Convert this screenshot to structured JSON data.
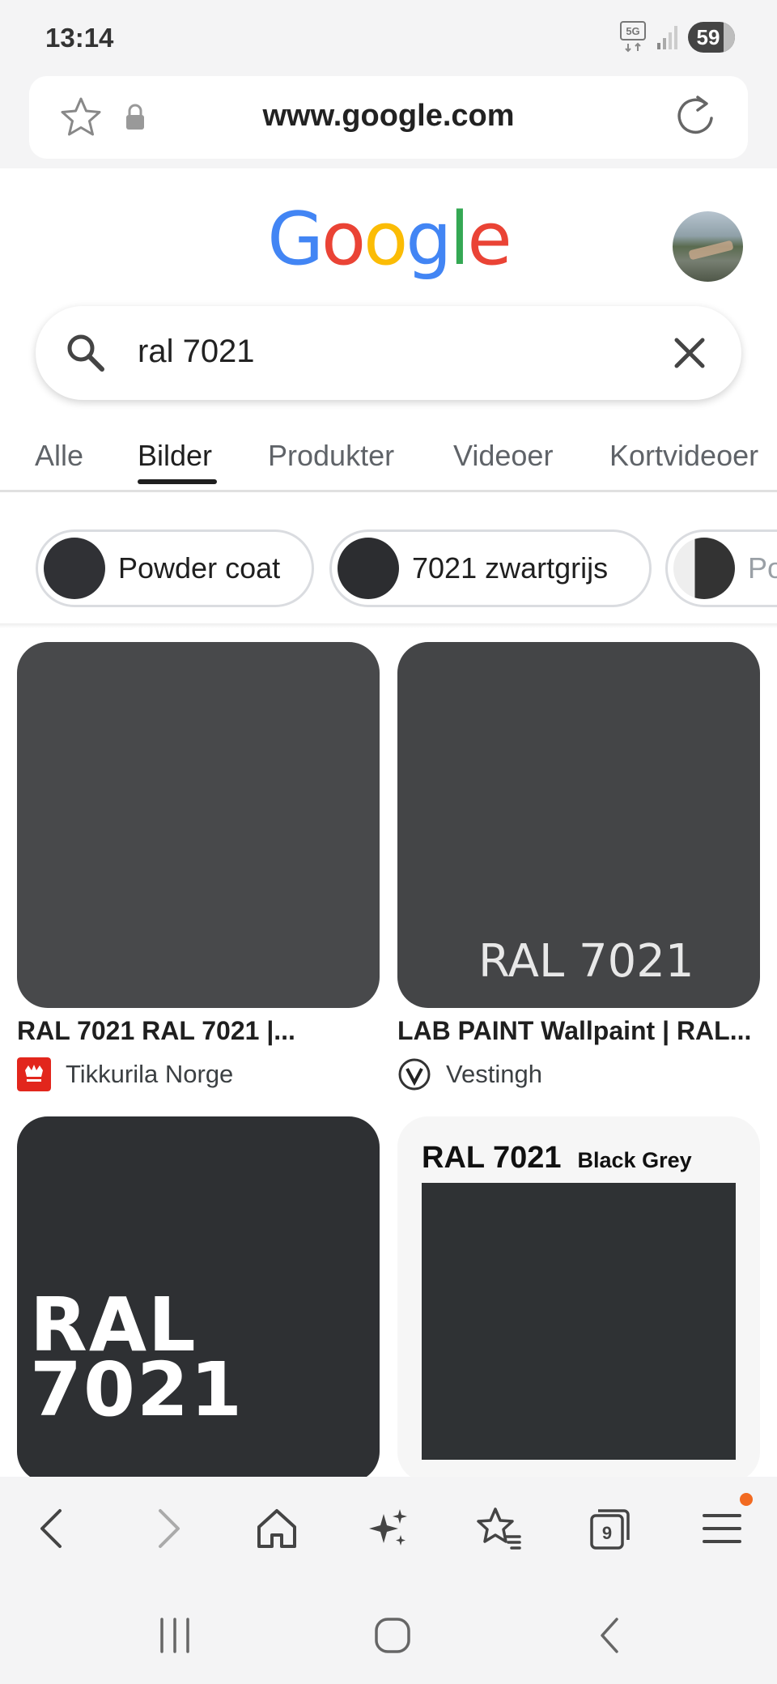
{
  "status_bar": {
    "time": "13:14",
    "network": "5G",
    "battery": "59"
  },
  "browser": {
    "url": "www.google.com"
  },
  "google": {
    "logo_letters": [
      "G",
      "o",
      "o",
      "g",
      "l",
      "e"
    ],
    "logo_colors": [
      "#4285F4",
      "#EA4335",
      "#FBBC05",
      "#4285F4",
      "#34A853",
      "#EA4335"
    ],
    "search_query": "ral 7021"
  },
  "tabs": [
    {
      "label": "Alle",
      "active": false
    },
    {
      "label": "Bilder",
      "active": true
    },
    {
      "label": "Produkter",
      "active": false
    },
    {
      "label": "Videoer",
      "active": false
    },
    {
      "label": "Kortvideoer",
      "active": false
    }
  ],
  "chips": [
    {
      "label": "Powder coat"
    },
    {
      "label": "7021 zwartgrijs"
    },
    {
      "label": "Po"
    }
  ],
  "results": [
    {
      "title": "RAL 7021 RAL 7021 |...",
      "source": "Tikkurila Norge",
      "image_color": "#48494b",
      "image_text": ""
    },
    {
      "title": "LAB PAINT Wallpaint | RAL...",
      "source": "Vestingh",
      "image_color": "#444547",
      "image_text": "RAL 7021"
    },
    {
      "title": "",
      "source": "",
      "image_color": "#2e3033",
      "image_text_line1": "RAL",
      "image_text_line2": "7021"
    },
    {
      "title": "",
      "source": "",
      "image_color": "#2f3234",
      "header_main": "RAL 7021",
      "header_sub": "Black Grey"
    }
  ],
  "toolbar": {
    "tabs_count": "9"
  },
  "colors": {
    "accent_orange": "#f26a21",
    "tikkurila_red": "#e2261c"
  }
}
